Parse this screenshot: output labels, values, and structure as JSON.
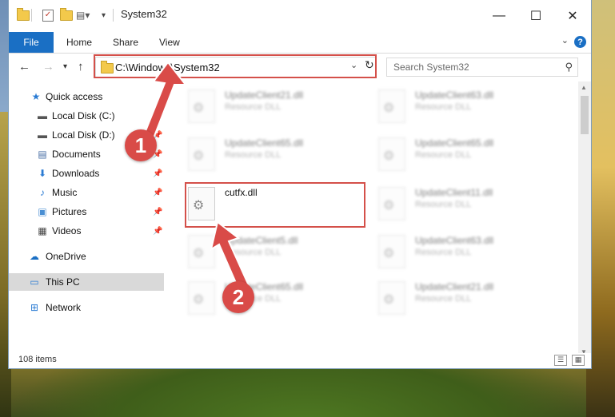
{
  "window": {
    "title": "System32",
    "controls": {
      "minimize": "—",
      "maximize": "☐",
      "close": "✕"
    }
  },
  "ribbon": {
    "tabs": [
      "File",
      "Home",
      "Share",
      "View"
    ],
    "help": "?"
  },
  "address": {
    "path": "C:\\Windows\\System32",
    "search_placeholder": "Search System32"
  },
  "nav": {
    "quick_access": "Quick access",
    "items": [
      {
        "label": "Local Disk (C:)",
        "icon": "drive-icon",
        "pinned": true
      },
      {
        "label": "Local Disk (D:)",
        "icon": "drive-icon",
        "pinned": true
      },
      {
        "label": "Documents",
        "icon": "documents-icon",
        "pinned": true
      },
      {
        "label": "Downloads",
        "icon": "downloads-icon",
        "pinned": true
      },
      {
        "label": "Music",
        "icon": "music-icon",
        "pinned": true
      },
      {
        "label": "Pictures",
        "icon": "pictures-icon",
        "pinned": true
      },
      {
        "label": "Videos",
        "icon": "videos-icon",
        "pinned": true
      }
    ],
    "onedrive": "OneDrive",
    "this_pc": "This PC",
    "network": "Network"
  },
  "files": {
    "left": [
      {
        "name": "UpdateClient21.dll",
        "type": "Resource DLL"
      },
      {
        "name": "UpdateClient65.dll",
        "type": "Resource DLL"
      },
      {
        "name": "cutfx.dll",
        "type": ""
      },
      {
        "name": "UpdateClient5.dll",
        "type": "Resource DLL"
      },
      {
        "name": "UpdateClient65.dll",
        "type": "Resource DLL"
      }
    ],
    "right": [
      {
        "name": "UpdateClient63.dll",
        "type": "Resource DLL"
      },
      {
        "name": "UpdateClient65.dll",
        "type": "Resource DLL"
      },
      {
        "name": "UpdateClient11.dll",
        "type": "Resource DLL"
      },
      {
        "name": "UpdateClient63.dll",
        "type": "Resource DLL"
      },
      {
        "name": "UpdateClient21.dll",
        "type": "Resource DLL"
      }
    ]
  },
  "status": {
    "item_count": "108 items"
  },
  "annotations": {
    "step1": "1",
    "step2": "2",
    "highlight_color": "#d4504a",
    "badge_color": "#d94b48"
  },
  "colors": {
    "accent": "#1a6fc4",
    "selected_bg": "#d9d9d9"
  }
}
